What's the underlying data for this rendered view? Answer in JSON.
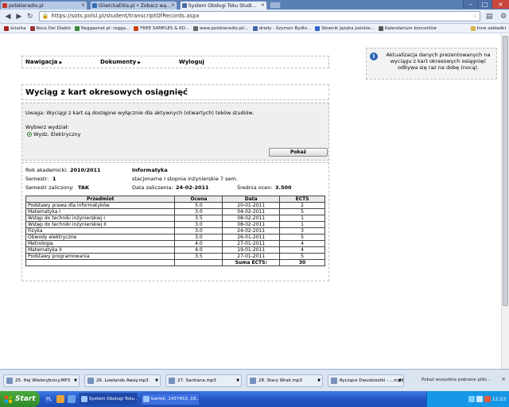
{
  "browser": {
    "tabs": [
      {
        "title": "polskieradio.pl",
        "fav": "#c0392b"
      },
      {
        "title": "GliwickaElita.pl • Zobacz wą...",
        "fav": "#2e6fb5"
      },
      {
        "title": "System Obsługi Toku Studi...",
        "fav": "#4a6aa0"
      }
    ],
    "url": "https://sots.polsl.pl/student/transcriptOfRecords.aspx",
    "bookmarks": [
      {
        "label": "ściarka",
        "color": "#aa2222"
      },
      {
        "label": "Roca Del Diablo",
        "color": "#993333"
      },
      {
        "label": "Reggaenet.pl: regga...",
        "color": "#3a8a3a"
      },
      {
        "label": "FREE SAMPLES & KO...",
        "color": "#cc4411"
      },
      {
        "label": "www.polskieradio.pl/...",
        "color": "#666666"
      },
      {
        "label": "dredy - Szymon Bydło...",
        "color": "#4466aa"
      },
      {
        "label": "Słownik języka polskie...",
        "color": "#3366cc"
      },
      {
        "label": "Kalendarium koncertów",
        "color": "#555555"
      }
    ],
    "other_bookmarks": "Inne zakładki"
  },
  "nav": {
    "items": [
      "Nawigacja",
      "Dokumenty",
      "Wyloguj"
    ]
  },
  "title": "Wyciąg z kart okresowych osiągnięć",
  "info": {
    "notice": "Uwaga: Wyciągi z kart są dostępne wyłącznie dla aktywnych (otwartych) toków studiów.",
    "choose_label": "Wybierz wydział:",
    "faculty": "Wydz. Elektryczny",
    "show_button": "Pokaż"
  },
  "details": {
    "year_label": "Rok akademicki:",
    "year_value": "2010/2011",
    "field": "Informatyka",
    "semester_label": "Semestr:",
    "semester_value": "1",
    "study_mode": "stacjonarne I stopnia inżynierskie 7 sem.",
    "passed_label": "Semestr zaliczony:",
    "passed_value": "TAK",
    "pass_date_label": "Data zaliczenia:",
    "pass_date_value": "24-02-2011",
    "avg_label": "Średnia ocen:",
    "avg_value": "3.500"
  },
  "table": {
    "headers": [
      "Przedmiot",
      "Ocena",
      "Data",
      "ECTS"
    ],
    "rows": [
      [
        "Podstawy prawa dla informatyków",
        "5.0",
        "20-01-2011",
        "2"
      ],
      [
        "Matematyka I",
        "3.0",
        "04-02-2011",
        "5"
      ],
      [
        "Wstęp do techniki inżynierskiej I",
        "3.5",
        "08-02-2011",
        "1"
      ],
      [
        "Wstęp do techniki inżynierskiej II",
        "3.0",
        "08-02-2011",
        "1"
      ],
      [
        "Fizyka",
        "3.0",
        "24-02-2011",
        "3"
      ],
      [
        "Obwody elektryczne",
        "3.0",
        "26-01-2011",
        "5"
      ],
      [
        "Metrologia",
        "4.0",
        "27-01-2011",
        "4"
      ],
      [
        "Matematyka II",
        "4.0",
        "19-01-2011",
        "4"
      ],
      [
        "Podstawy programowania",
        "3.5",
        "27-01-2011",
        "5"
      ]
    ],
    "sum_label": "Suma ECTS:",
    "sum_value": "30"
  },
  "sidebar": {
    "message": "Aktualizacja danych prezentowanych na wyciągu z kart okresowych osiągnięć odbywa się raz na dobę (nocą)."
  },
  "downloads": {
    "items": [
      "25. Hej Wielorybnicy.MP3",
      "26. Lowlands Away.mp3",
      "27. Santiana.mp3",
      "28. Stary Wrak.mp3",
      "Ryczące Dwudziestki - ...mp3"
    ],
    "show_all": "Pokaż wszystkie pobrane pliki..."
  },
  "taskbar": {
    "start": "Start",
    "lang": "PL",
    "tasks": [
      "System Obsługi Toku ...",
      "bartek, 1437453, 19..."
    ],
    "clock": "12:53"
  }
}
